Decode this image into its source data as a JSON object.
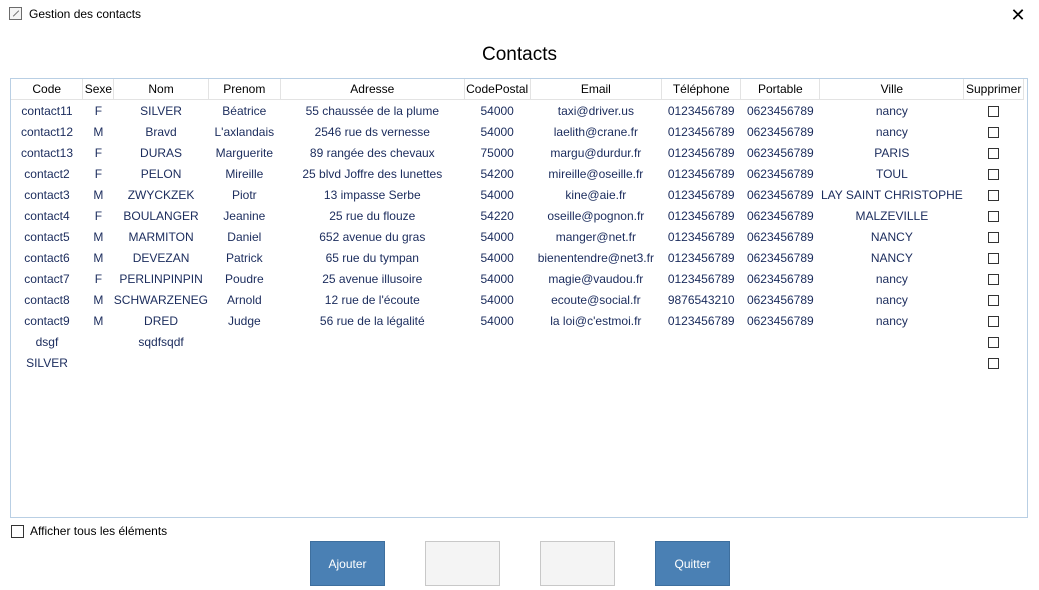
{
  "window": {
    "title": "Gestion des contacts",
    "close_glyph": "✕"
  },
  "header": {
    "title": "Contacts"
  },
  "table": {
    "columns": [
      "Code",
      "Sexe",
      "Nom",
      "Prenom",
      "Adresse",
      "CodePostal",
      "Email",
      "Téléphone",
      "Portable",
      "Ville",
      "Supprimer"
    ],
    "rows": [
      [
        "contact11",
        "F",
        "SILVER",
        "Béatrice",
        "55 chaussée de la plume",
        "54000",
        "taxi@driver.us",
        "0123456789",
        "0623456789",
        "nancy"
      ],
      [
        "contact12",
        "M",
        "Bravd",
        "L'axlandais",
        "2546 rue ds vernesse",
        "54000",
        "laelith@crane.fr",
        "0123456789",
        "0623456789",
        "nancy"
      ],
      [
        "contact13",
        "F",
        "DURAS",
        "Marguerite",
        "89 rangée des chevaux",
        "75000",
        "margu@durdur.fr",
        "0123456789",
        "0623456789",
        "PARIS"
      ],
      [
        "contact2",
        "F",
        "PELON",
        "Mireille",
        "25 blvd Joffre des lunettes",
        "54200",
        "mireille@oseille.fr",
        "0123456789",
        "0623456789",
        "TOUL"
      ],
      [
        "contact3",
        "M",
        "ZWYCKZEK",
        "Piotr",
        "13 impasse Serbe",
        "54000",
        "kine@aie.fr",
        "0123456789",
        "0623456789",
        "LAY SAINT CHRISTOPHE"
      ],
      [
        "contact4",
        "F",
        "BOULANGER",
        "Jeanine",
        "25 rue du flouze",
        "54220",
        "oseille@pognon.fr",
        "0123456789",
        "0623456789",
        "MALZEVILLE"
      ],
      [
        "contact5",
        "M",
        "MARMITON",
        "Daniel",
        "652 avenue du gras",
        "54000",
        "manger@net.fr",
        "0123456789",
        "0623456789",
        "NANCY"
      ],
      [
        "contact6",
        "M",
        "DEVEZAN",
        "Patrick",
        "65 rue du tympan",
        "54000",
        "bienentendre@net3.fr",
        "0123456789",
        "0623456789",
        "NANCY"
      ],
      [
        "contact7",
        "F",
        "PERLINPINPIN",
        "Poudre",
        "25 avenue illusoire",
        "54000",
        "magie@vaudou.fr",
        "0123456789",
        "0623456789",
        "nancy"
      ],
      [
        "contact8",
        "M",
        "SCHWARZENEGGER",
        "Arnold",
        "12 rue de l'écoute",
        "54000",
        "ecoute@social.fr",
        "9876543210",
        "0623456789",
        "nancy"
      ],
      [
        "contact9",
        "M",
        "DRED",
        "Judge",
        "56 rue de la légalité",
        "54000",
        "la loi@c'estmoi.fr",
        "0123456789",
        "0623456789",
        "nancy"
      ],
      [
        "dsgf",
        "",
        "sqdfsqdf",
        "",
        "",
        "",
        "",
        "",
        "",
        ""
      ],
      [
        "SILVER",
        "",
        "",
        "",
        "",
        "",
        "",
        "",
        "",
        ""
      ]
    ]
  },
  "footer": {
    "show_all_label": "Afficher tous les éléments",
    "buttons": {
      "add": "Ajouter",
      "quit": "Quitter"
    }
  },
  "colors": {
    "accent": "#4a80b4",
    "grid_border": "#b9cfe4",
    "cell_text": "#1a2b5c"
  }
}
